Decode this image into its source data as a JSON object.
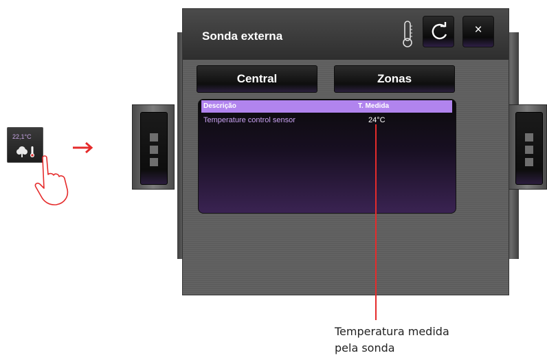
{
  "widget": {
    "temperature": "22,1°C"
  },
  "panel": {
    "title": "Sonda externa",
    "close_label": "×",
    "tabs": [
      {
        "label": "Central"
      },
      {
        "label": "Zonas"
      }
    ],
    "table": {
      "columns": [
        "Descrição",
        "T. Medida"
      ],
      "rows": [
        {
          "description": "Temperature control sensor",
          "temperature": "24°C"
        }
      ]
    }
  },
  "callout": {
    "line1": "Temperatura medida",
    "line2": "pela sonda"
  },
  "colors": {
    "accent": "#b184ee",
    "arrow": "#e52b2b",
    "row_text": "#c9a2f2"
  }
}
